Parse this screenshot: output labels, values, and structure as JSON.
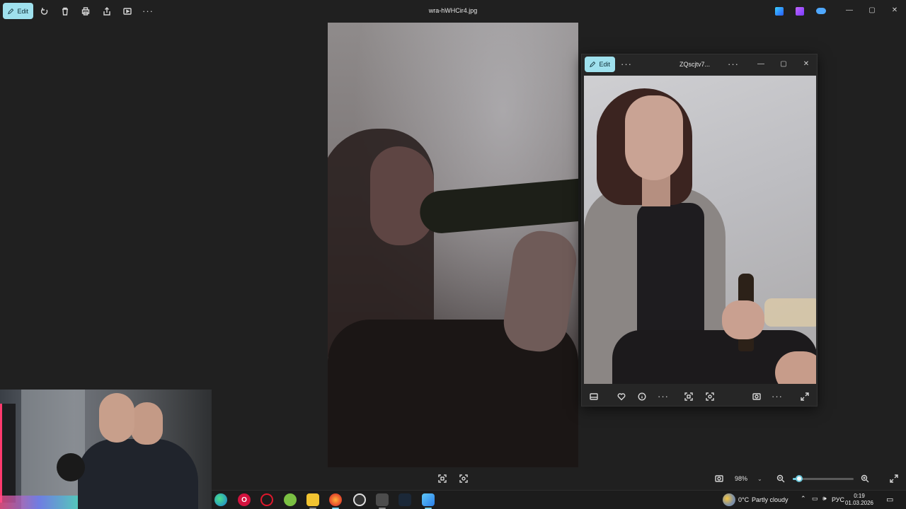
{
  "main_window": {
    "edit_label": "Edit",
    "title": "wra-hWHCir4.jpg",
    "toolbar_icons": [
      "rotate-icon",
      "delete-icon",
      "print-icon",
      "share-icon",
      "slideshow-icon",
      "more-icon"
    ],
    "more_label": "···",
    "app_icons": [
      "clipchamp-icon",
      "video-editor-icon",
      "onedrive-icon"
    ],
    "controls": {
      "minimize": "—",
      "maximize": "▢",
      "close": "✕"
    }
  },
  "second_window": {
    "edit_label": "Edit",
    "more_label": "···",
    "title": "ZQscjtv7...",
    "title_more": "···",
    "controls": {
      "minimize": "—",
      "maximize": "▢",
      "close": "✕"
    },
    "bottom_icons": [
      "filmstrip-icon",
      "favorite-icon",
      "info-icon",
      "more-icon",
      "crop-icon",
      "fit-icon",
      "screen-icon",
      "more-icon",
      "expand-icon"
    ],
    "bottom_more": "···"
  },
  "bottom_bar": {
    "zoom_value": "98%",
    "zoom_level": 0.1,
    "icons": [
      "crop-icon",
      "fit-icon",
      "screen-icon",
      "zoom-out-icon",
      "zoom-in-icon",
      "fullscreen-icon"
    ]
  },
  "taskbar": {
    "apps": [
      "edge-icon",
      "opera-gx-icon",
      "opera-icon",
      "android-icon",
      "file-explorer-icon",
      "firefox-icon",
      "chrome-icon",
      "calendar-icon",
      "steam-icon",
      "photos-icon"
    ],
    "weather_temp": "0°C",
    "weather_text": "Partly cloudy",
    "language": "РУС",
    "time": "0:19",
    "date": "01.03.2026"
  }
}
